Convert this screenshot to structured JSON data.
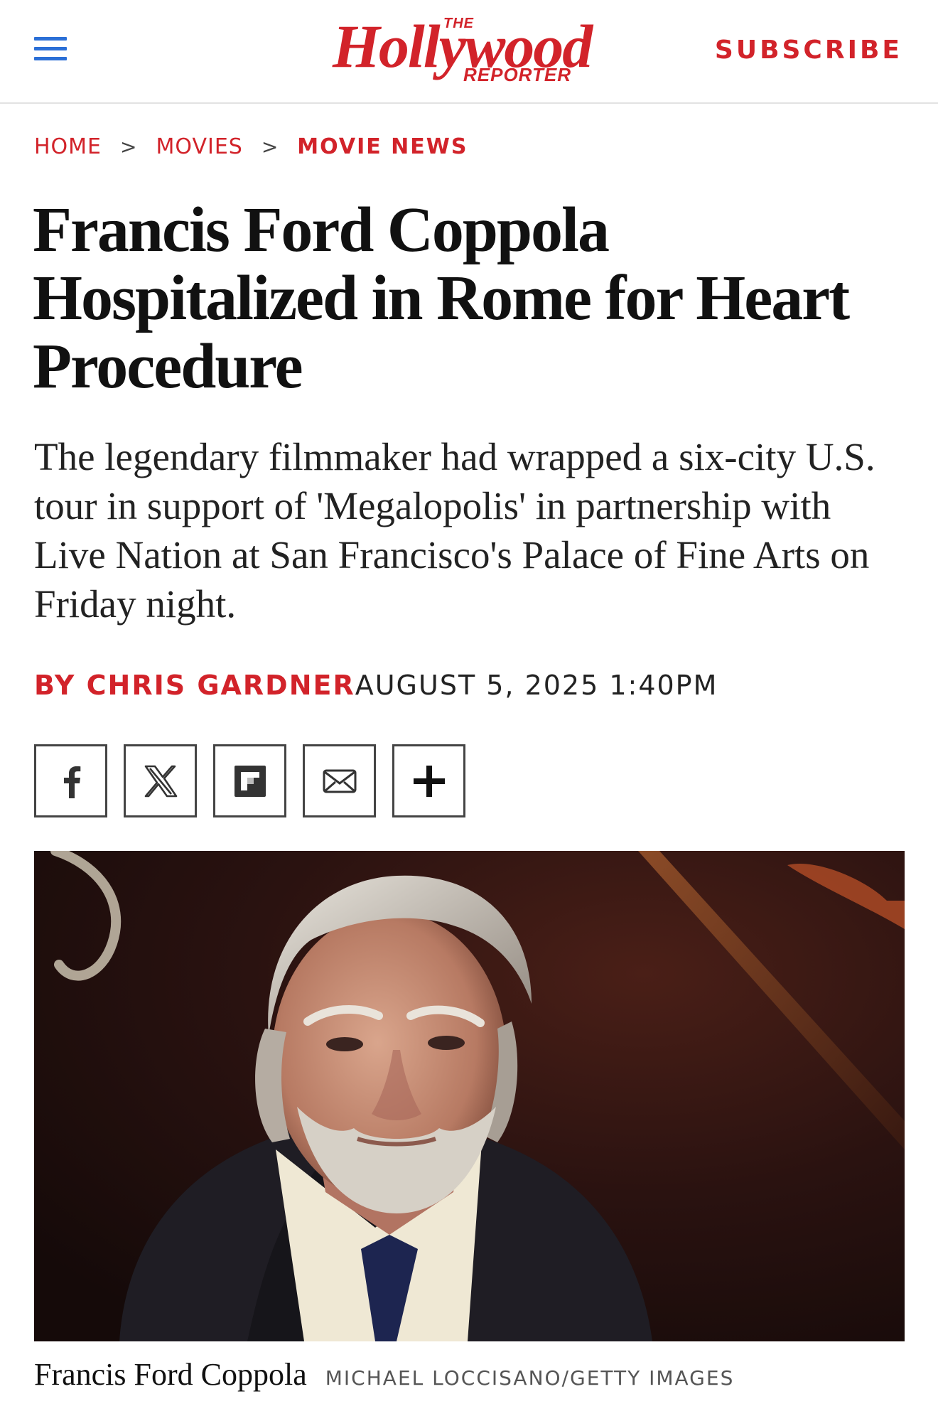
{
  "header": {
    "menu_icon": "hamburger-menu-icon",
    "logo": {
      "the": "THE",
      "name": "Hollywood",
      "sub": "REPORTER"
    },
    "subscribe_label": "SUBSCRIBE",
    "accent_color": "#d2232a",
    "menu_color": "#2b6fd6"
  },
  "breadcrumb": {
    "items": [
      "HOME",
      "MOVIES",
      "MOVIE NEWS"
    ],
    "separator": ">"
  },
  "article": {
    "headline": "Francis Ford Coppola Hospitalized in Rome for Heart Procedure",
    "dek": "The legendary filmmaker had wrapped a six-city U.S. tour in support of 'Megalopolis' in partnership with Live Nation at San Francisco's Palace of Fine Arts on Friday night.",
    "byline": "BY CHRIS GARDNER",
    "date": "AUGUST 5, 2025 1:40PM"
  },
  "share": {
    "buttons": [
      "facebook-icon",
      "x-icon",
      "flipboard-icon",
      "email-icon",
      "plus-icon"
    ]
  },
  "photo": {
    "subject": "portrait-photo",
    "caption": "Francis Ford Coppola",
    "credit": "MICHAEL LOCCISANO/GETTY IMAGES"
  }
}
